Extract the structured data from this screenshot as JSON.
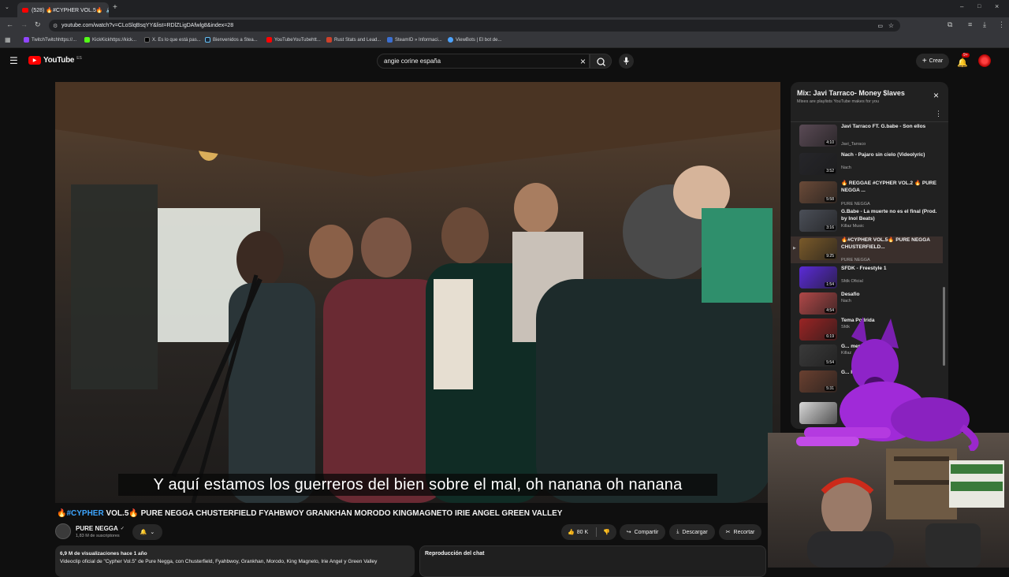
{
  "browser": {
    "tab_title": "(528) 🔥#CYPHER VOL.5🔥",
    "url": "youtube.com/watch?v=CLoSlqBsqYY&list=RDlZLigDAfwlg8&index=28",
    "bookmarks": [
      {
        "label": "TwitchTwitchhttps://...",
        "color": "#9146ff"
      },
      {
        "label": "KickKickhttps://kick...",
        "color": "#53fc18"
      },
      {
        "label": "X. Es lo que está pas...",
        "color": "#000000"
      },
      {
        "label": "Bienvenidos a Stea...",
        "color": "#1b2838"
      },
      {
        "label": "YouTubeYouTubehtt...",
        "color": "#ff0000"
      },
      {
        "label": "Rust Stats and Lead...",
        "color": "#cd412b"
      },
      {
        "label": "SteamID » Informaci...",
        "color": "#3b6fd1"
      },
      {
        "label": "ViewBots | El bot de...",
        "color": "#4da3ff"
      }
    ]
  },
  "header": {
    "logo_text": "YouTube",
    "region": "ES",
    "search_value": "angie corine españa",
    "create_label": "Crear",
    "notification_count": "9+"
  },
  "video": {
    "subtitle": "Y aquí estamos los guerreros del bien sobre el mal, oh nanana oh nanana",
    "title_hashtag": "#CYPHER",
    "title_rest": " VOL.5🔥 PURE NEGGA CHUSTERFIELD FYAHBWOY GRANKHAN MORODO KINGMAGNETO IRIE ANGEL GREEN VALLEY",
    "title_prefix": "🔥",
    "channel": "PURE NEGGA",
    "subscribers": "1,83 M de suscriptores",
    "likes": "80 K",
    "share_label": "Compartir",
    "download_label": "Descargar",
    "clip_label": "Recortar",
    "views_line": "6,9 M de visualizaciones  hace 1 año",
    "description": "Videoclip oficial de \"Cypher Vol.5\" de Pure Negga, con Chusterfield, Fyahbwoy, Grankhan, Morodo, King Magneto, Irie Angel y Green Valley",
    "chat_replay_label": "Reproducción del chat"
  },
  "playlist": {
    "title": "Mix: Javi Tarraco- Money $laves",
    "subtitle": "Mixes are playlists YouTube makes for you",
    "items": [
      {
        "title": "Javi Tarraco FT. G.babe - Son ellos",
        "channel": "Javi_Tarraco",
        "duration": "4:10",
        "color": "#5a4a55"
      },
      {
        "title": "Nach - Pajaro sin cielo (Videolyric)",
        "channel": "Nach",
        "duration": "3:52",
        "color": "#26262a"
      },
      {
        "title": "🔥 REGGAE #CYPHER VOL.2 🔥 PURE NEGGA ...",
        "channel": "PURE NEGGA",
        "duration": "5:58",
        "color": "#6a4a38"
      },
      {
        "title": "G.Babe - La muerte no es el final (Prod. by Inol Beats)",
        "channel": "Killaz Music",
        "duration": "3:16",
        "color": "#4b4f58"
      },
      {
        "title": "🔥#CYPHER VOL.5🔥 PURE NEGGA CHUSTERFIELD...",
        "channel": "PURE NEGGA",
        "duration": "9:25",
        "color": "#7a5a2a"
      },
      {
        "title": "SFDK - Freestyle 1",
        "channel": "Sfdk Oficial",
        "duration": "1:54",
        "color": "#5b2bd8"
      },
      {
        "title": "Desafio",
        "channel": "Nach",
        "duration": "4:54",
        "color": "#b04848"
      },
      {
        "title": "Tema Podrida",
        "channel": "Sfdk",
        "duration": "6:19",
        "color": "#9a2424"
      },
      {
        "title": "G... mentiras (P...",
        "channel": "Killaz",
        "duration": "5:54",
        "color": "#3a3a3a"
      },
      {
        "title": "G... Finales (Prod b...",
        "channel": "",
        "duration": "5:31",
        "color": "#6a4030"
      },
      {
        "title": "",
        "channel": "",
        "duration": "",
        "color": "#d8d8d8"
      }
    ]
  }
}
